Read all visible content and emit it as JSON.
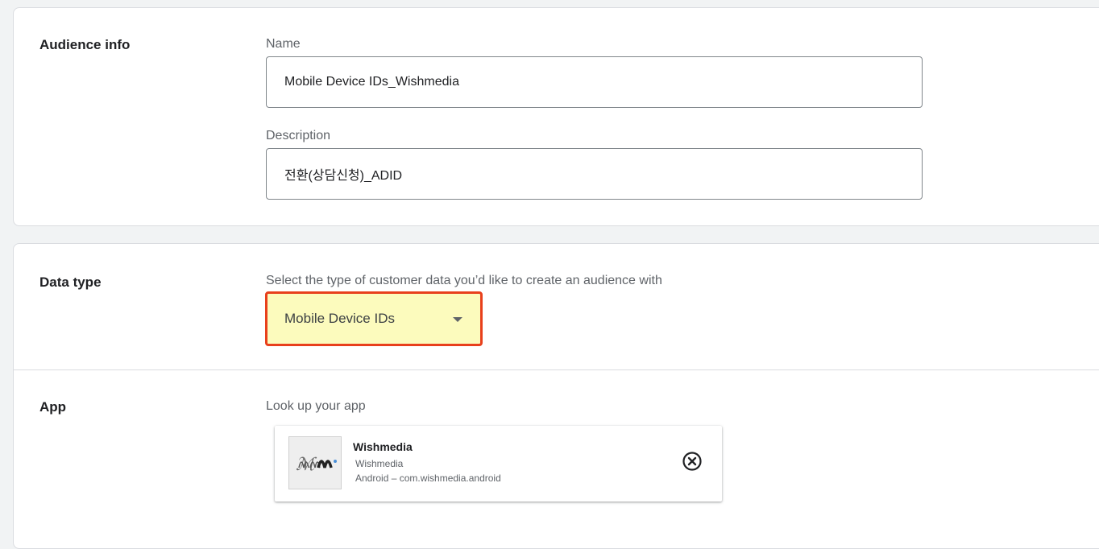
{
  "audience_info": {
    "section_title": "Audience info",
    "name_label": "Name",
    "name_value": "Mobile Device IDs_Wishmedia",
    "description_label": "Description",
    "description_value": "전환(상담신청)_ADID"
  },
  "data_type": {
    "section_title": "Data type",
    "prompt": "Select the type of customer data you’d like to create an audience with",
    "selected_value": "Mobile Device IDs",
    "highlight_color": "#fcfbbd",
    "highlight_border_color": "#e8401c"
  },
  "app": {
    "section_title": "App",
    "prompt": "Look up your app",
    "selected_app": {
      "name": "Wishmedia",
      "publisher": "Wishmedia",
      "platform": "Android – com.wishmedia.android",
      "logo_icon": "wishmedia-logo",
      "remove_icon": "close-circle-icon"
    }
  }
}
